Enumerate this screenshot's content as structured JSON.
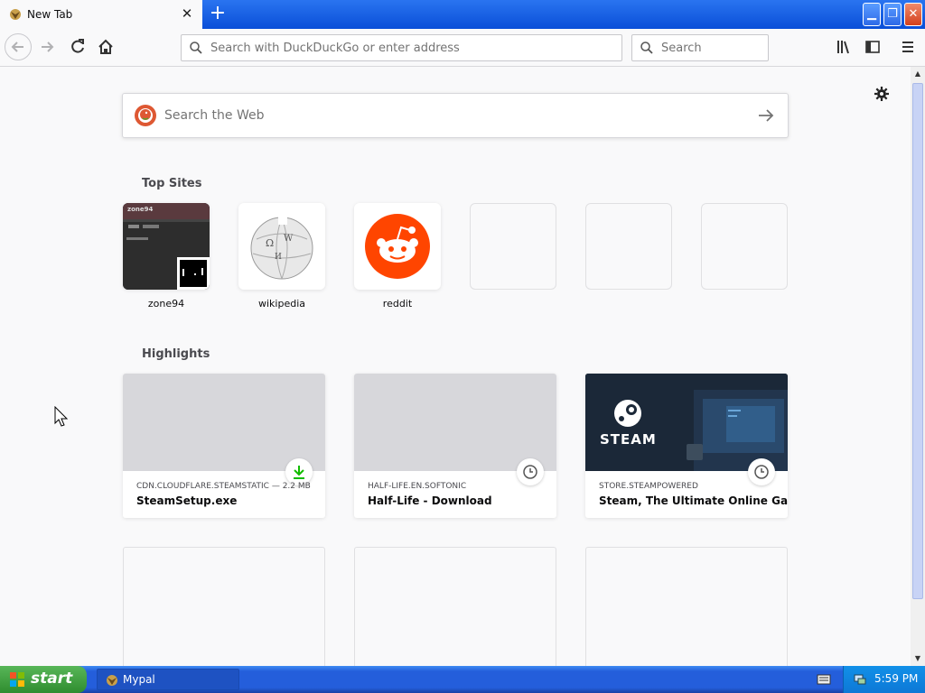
{
  "browser": {
    "tab_title": "New Tab",
    "url_placeholder": "Search with DuckDuckGo or enter address",
    "search_placeholder": "Search"
  },
  "newtab": {
    "web_search_placeholder": "Search the Web",
    "top_sites_heading": "Top Sites",
    "top_sites": [
      {
        "label": "zone94"
      },
      {
        "label": "wikipedia"
      },
      {
        "label": "reddit"
      }
    ],
    "highlights_heading": "Highlights",
    "highlights": [
      {
        "source": "CDN.CLOUDFLARE.STEAMSTATIC — 2.2 MB",
        "title": "SteamSetup.exe",
        "badge": "download-icon"
      },
      {
        "source": "HALF-LIFE.EN.SOFTONIC",
        "title": "Half-Life - Download",
        "badge": "clock-icon"
      },
      {
        "source": "STORE.STEAMPOWERED",
        "title": "Steam, The Ultimate Online Ga...",
        "badge": "clock-icon",
        "image_text": "STEAM"
      }
    ],
    "thumb_texts": {
      "zone94": "zone94"
    }
  },
  "taskbar": {
    "start_label": "start",
    "task_label": "Mypal",
    "clock": "5:59 PM"
  },
  "colors": {
    "xp_blue": "#245edb",
    "reddit_orange": "#ff4500",
    "steam_dark": "#1b2838",
    "download_green": "#12bc00"
  }
}
